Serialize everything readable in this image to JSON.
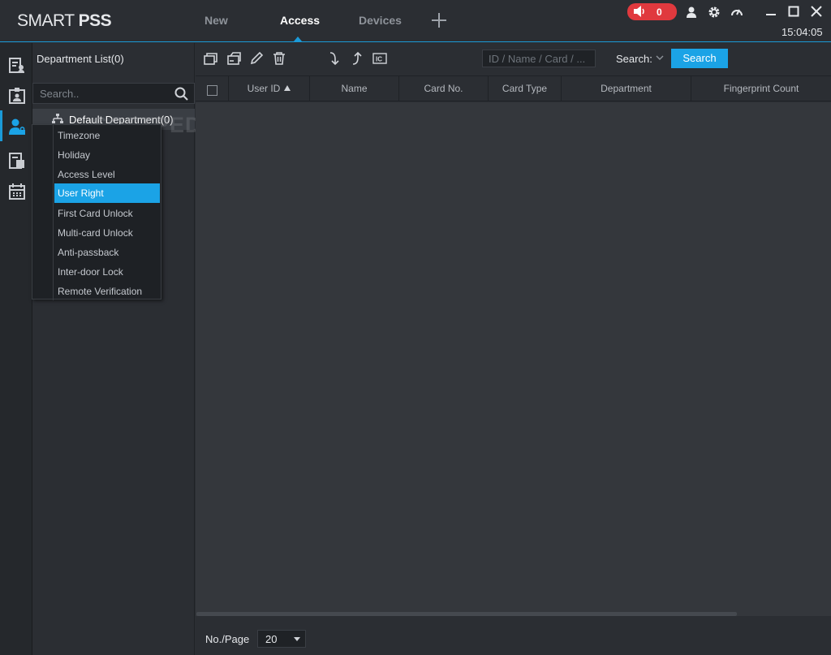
{
  "app": {
    "logo_light": "SMART ",
    "logo_bold": "PSS",
    "clock": "15:04:05"
  },
  "tabs": [
    {
      "label": "New"
    },
    {
      "label": "Access"
    },
    {
      "label": "Devices"
    }
  ],
  "alarm": {
    "count": "0",
    "color": "#e0393e"
  },
  "department": {
    "title": "Department List(0)",
    "search_placeholder": "Search..",
    "root_label": "Default Department(0)"
  },
  "context_menu": {
    "items": [
      {
        "label": "Timezone"
      },
      {
        "label": "Holiday"
      },
      {
        "label": "Access Level"
      },
      {
        "label": "User Right"
      },
      {
        "label": "First Card Unlock"
      },
      {
        "label": "Multi-card Unlock"
      },
      {
        "label": "Anti-passback"
      },
      {
        "label": "Inter-door Lock"
      },
      {
        "label": "Remote Verification"
      }
    ],
    "highlighted": "User Right"
  },
  "toolbar": {
    "id_search_placeholder": "ID / Name / Card / ...",
    "search_label": "Search:",
    "search_button": "Search"
  },
  "table": {
    "columns": [
      {
        "label": "User ID"
      },
      {
        "label": "Name"
      },
      {
        "label": "Card No."
      },
      {
        "label": "Card Type"
      },
      {
        "label": "Department"
      },
      {
        "label": "Fingerprint Count"
      }
    ],
    "rows": []
  },
  "footer": {
    "per_page_label": "No./Page",
    "per_page_value": "20"
  },
  "watermark": "SOFTPEDIA",
  "colors": {
    "accent": "#1ba3e6",
    "background": "#2b2e33",
    "alarm": "#e0393e"
  }
}
